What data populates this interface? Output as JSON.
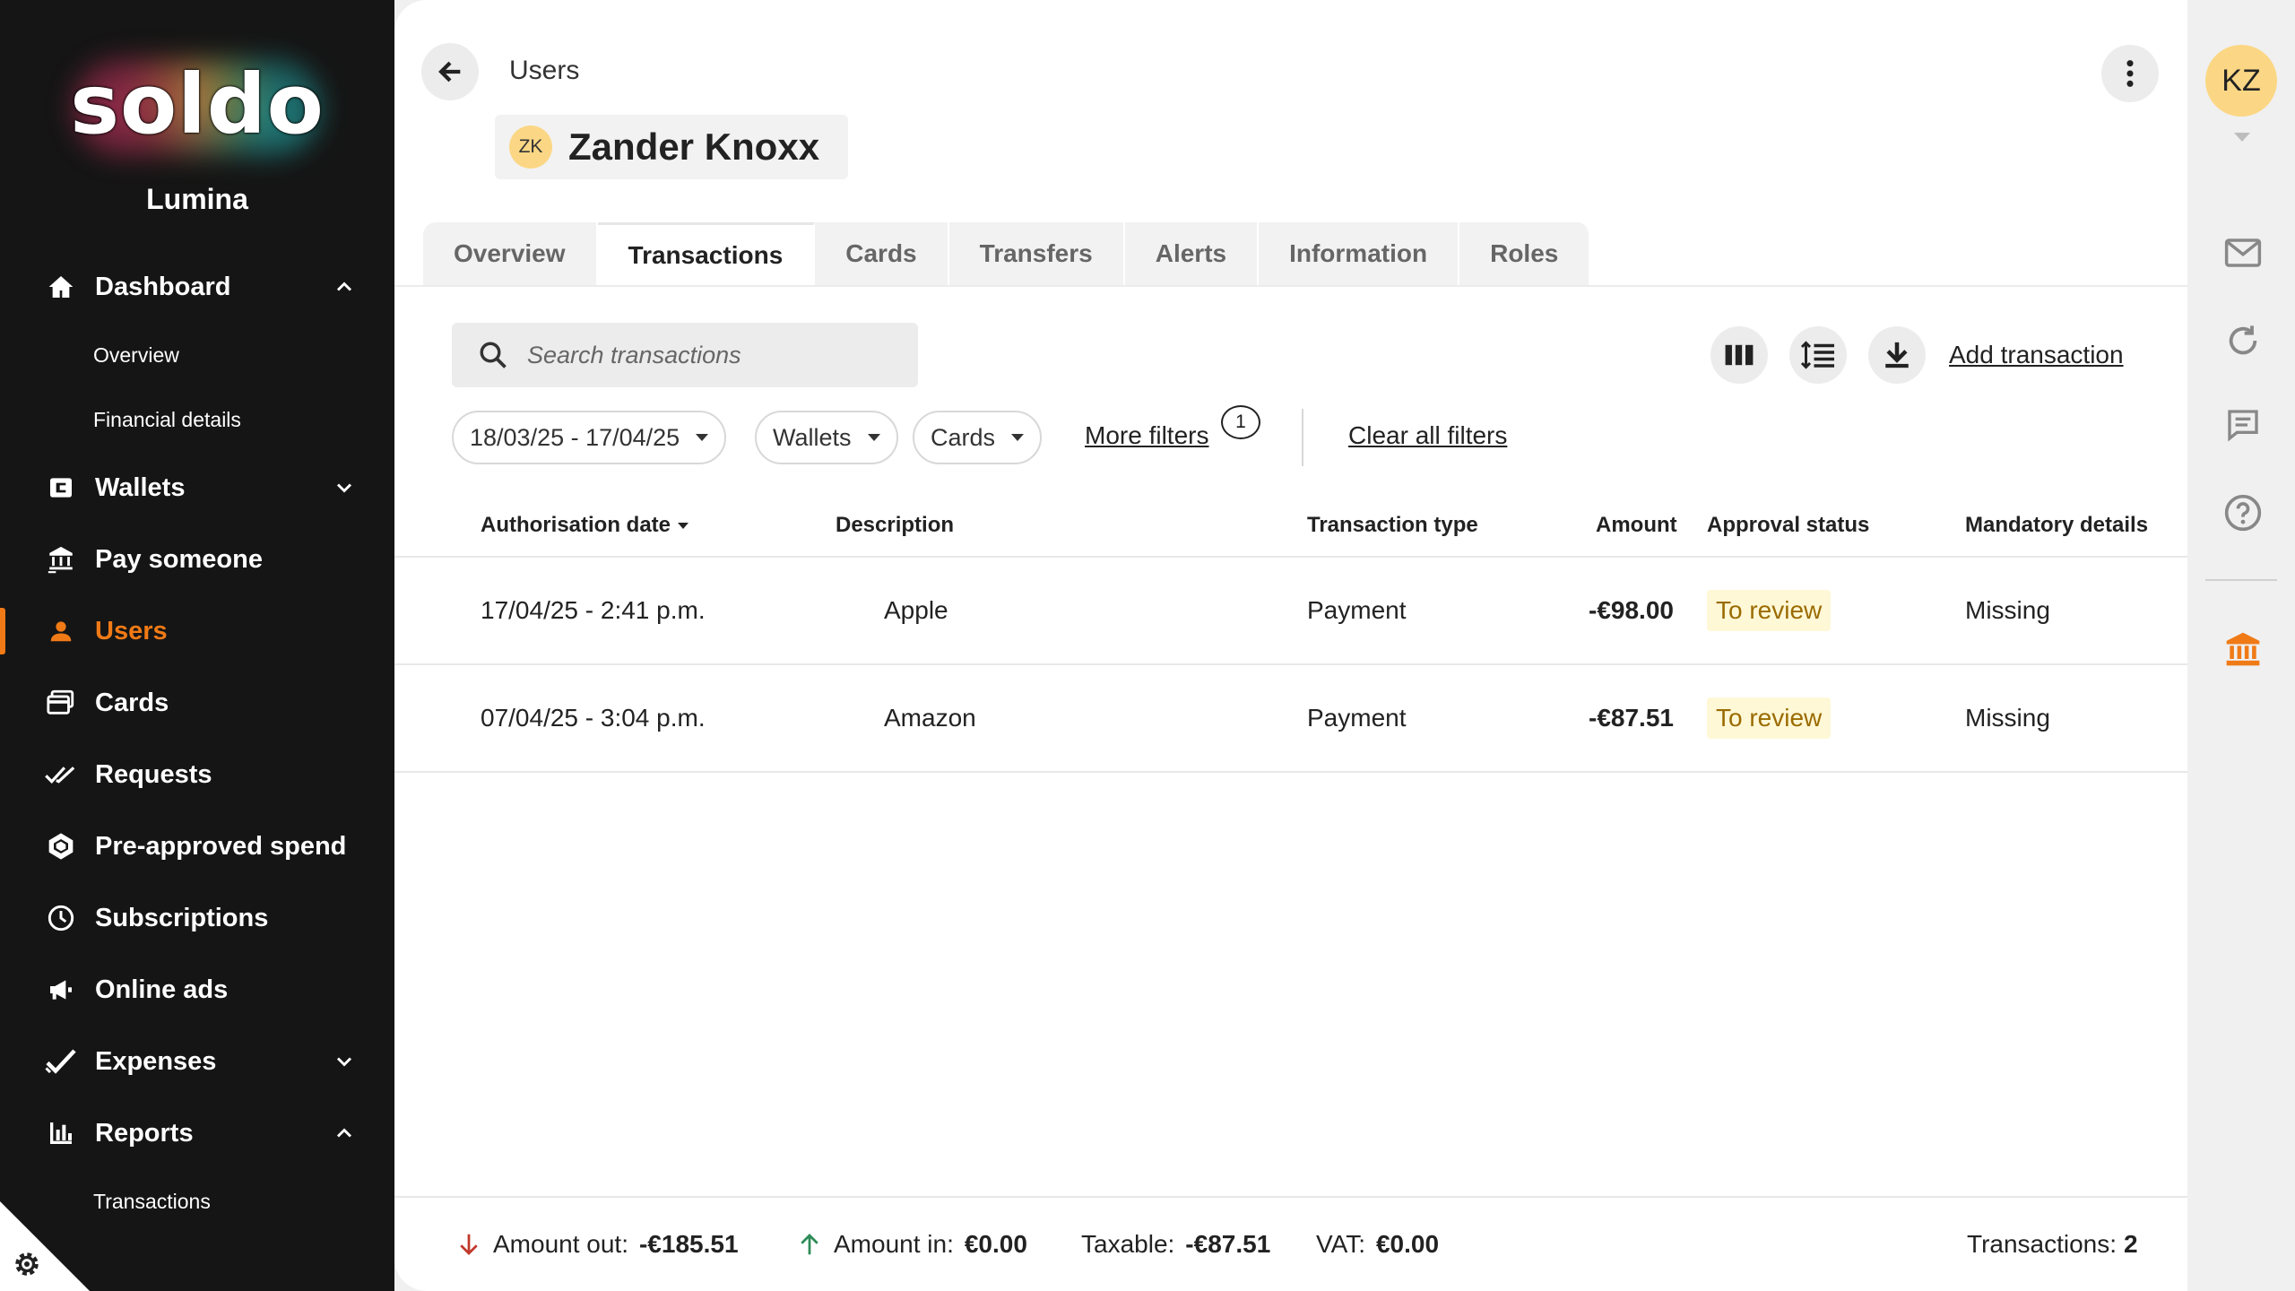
{
  "sidebar": {
    "logo_text": "soldo",
    "org_name": "Lumina",
    "nav": {
      "dashboard": "Dashboard",
      "overview": "Overview",
      "financial_details": "Financial details",
      "wallets": "Wallets",
      "pay_someone": "Pay someone",
      "users": "Users",
      "cards": "Cards",
      "requests": "Requests",
      "pre_approved_spend": "Pre-approved spend",
      "subscriptions": "Subscriptions",
      "online_ads": "Online ads",
      "expenses": "Expenses",
      "reports": "Reports",
      "transactions": "Transactions"
    }
  },
  "header": {
    "breadcrumb": "Users",
    "user_initials": "ZK",
    "user_name": "Zander Knoxx"
  },
  "tabs": [
    "Overview",
    "Transactions",
    "Cards",
    "Transfers",
    "Alerts",
    "Information",
    "Roles"
  ],
  "active_tab": "Transactions",
  "toolbar": {
    "search_placeholder": "Search transactions",
    "add_transaction": "Add transaction"
  },
  "filters": {
    "date_range": "18/03/25 - 17/04/25",
    "wallets": "Wallets",
    "cards": "Cards",
    "more_filters": "More filters",
    "more_filters_count": "1",
    "clear_all": "Clear all filters"
  },
  "table": {
    "headers": {
      "date": "Authorisation date",
      "description": "Description",
      "type": "Transaction type",
      "amount": "Amount",
      "approval": "Approval status",
      "mandatory": "Mandatory details"
    },
    "rows": [
      {
        "date": "17/04/25 - 2:41 p.m.",
        "description": "Apple",
        "type": "Payment",
        "amount": "-€98.00",
        "approval": "To review",
        "mandatory": "Missing"
      },
      {
        "date": "07/04/25 - 3:04 p.m.",
        "description": "Amazon",
        "type": "Payment",
        "amount": "-€87.51",
        "approval": "To review",
        "mandatory": "Missing"
      }
    ]
  },
  "footer": {
    "amount_out_label": "Amount out:",
    "amount_out": "-€185.51",
    "amount_in_label": "Amount in:",
    "amount_in": "€0.00",
    "taxable_label": "Taxable:",
    "taxable": "-€87.51",
    "vat_label": "VAT:",
    "vat": "€0.00",
    "transactions_label": "Transactions:",
    "transactions_count": "2"
  },
  "rail": {
    "avatar_initials": "KZ"
  },
  "colors": {
    "accent": "#f07a16",
    "sidebar_bg": "#151515",
    "status_bg": "#fff8d6",
    "status_text": "#9a6b00",
    "arrow_out": "#c0392b",
    "arrow_in": "#2e8b57"
  }
}
